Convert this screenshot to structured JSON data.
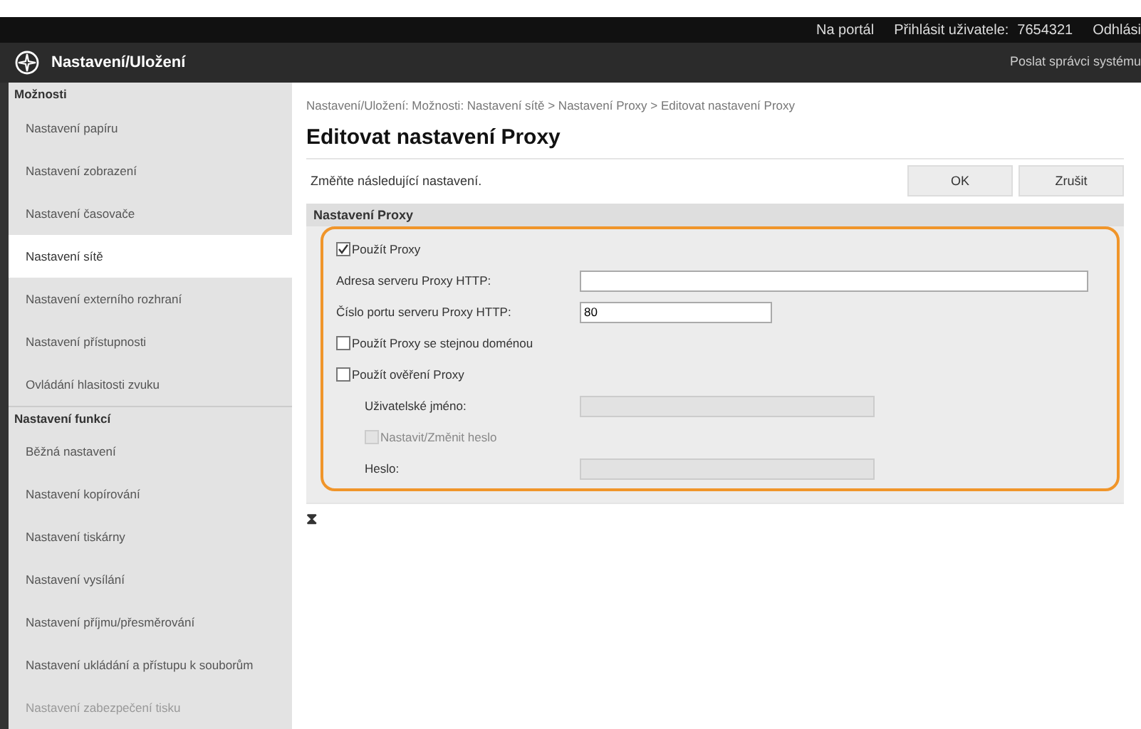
{
  "top_bar": {
    "links": [
      "Na portál",
      "Přihlásit uživatele:",
      "7654321",
      "Odhlási"
    ]
  },
  "header": {
    "title": "Nastavení/Uložení",
    "link": "Poslat správci systému"
  },
  "sidebar": {
    "sections": [
      {
        "heading": "Možnosti",
        "items": [
          {
            "label": "Nastavení papíru",
            "selected": false
          },
          {
            "label": "Nastavení zobrazení",
            "selected": false
          },
          {
            "label": "Nastavení časovače",
            "selected": false
          },
          {
            "label": "Nastavení sítě",
            "selected": true
          },
          {
            "label": "Nastavení externího rozhraní",
            "selected": false
          },
          {
            "label": "Nastavení přístupnosti",
            "selected": false
          },
          {
            "label": "Ovládání hlasitosti zvuku",
            "selected": false
          }
        ]
      },
      {
        "heading": "Nastavení funkcí",
        "items": [
          {
            "label": "Běžná nastavení",
            "selected": false
          },
          {
            "label": "Nastavení kopírování",
            "selected": false
          },
          {
            "label": "Nastavení tiskárny",
            "selected": false
          },
          {
            "label": "Nastavení vysílání",
            "selected": false
          },
          {
            "label": "Nastavení příjmu/přesměrování",
            "selected": false
          },
          {
            "label": "Nastavení ukládání a přístupu k souborům",
            "selected": false
          },
          {
            "label": "Nastavení zabezpečení tisku",
            "selected": false
          }
        ]
      }
    ]
  },
  "breadcrumb": "Nastavení/Uložení: Možnosti: Nastavení sítě > Nastavení Proxy > Editovat nastavení Proxy",
  "page_title": "Editovat nastavení Proxy",
  "instruction": "Změňte následující nastavení.",
  "buttons": [
    "OK",
    "Zrušit"
  ],
  "section_title": "Nastavení Proxy",
  "rows": [
    {
      "kind": "checkbox",
      "label": "Použít Proxy",
      "checked": true,
      "disabled": false,
      "indent": false
    },
    {
      "kind": "field",
      "label": "Adresa serveru Proxy HTTP:",
      "value": "",
      "wide": true,
      "disabled": false,
      "indent": false
    },
    {
      "kind": "field",
      "label": "Číslo portu serveru Proxy HTTP:",
      "value": "80",
      "wide": false,
      "disabled": false,
      "indent": false
    },
    {
      "kind": "checkbox",
      "label": "Použít Proxy se stejnou doménou",
      "checked": false,
      "disabled": false,
      "indent": false
    },
    {
      "kind": "checkbox",
      "label": "Použít ověření Proxy",
      "checked": false,
      "disabled": false,
      "indent": false
    },
    {
      "kind": "field",
      "label": "Uživatelské jméno:",
      "value": "",
      "wide": false,
      "disabled": true,
      "indent": true
    },
    {
      "kind": "checkbox",
      "label": "Nastavit/Změnit heslo",
      "checked": false,
      "disabled": true,
      "indent": true
    },
    {
      "kind": "field",
      "label": "Heslo:",
      "value": "",
      "wide": false,
      "disabled": true,
      "indent": true
    }
  ],
  "top_link": "⧗"
}
